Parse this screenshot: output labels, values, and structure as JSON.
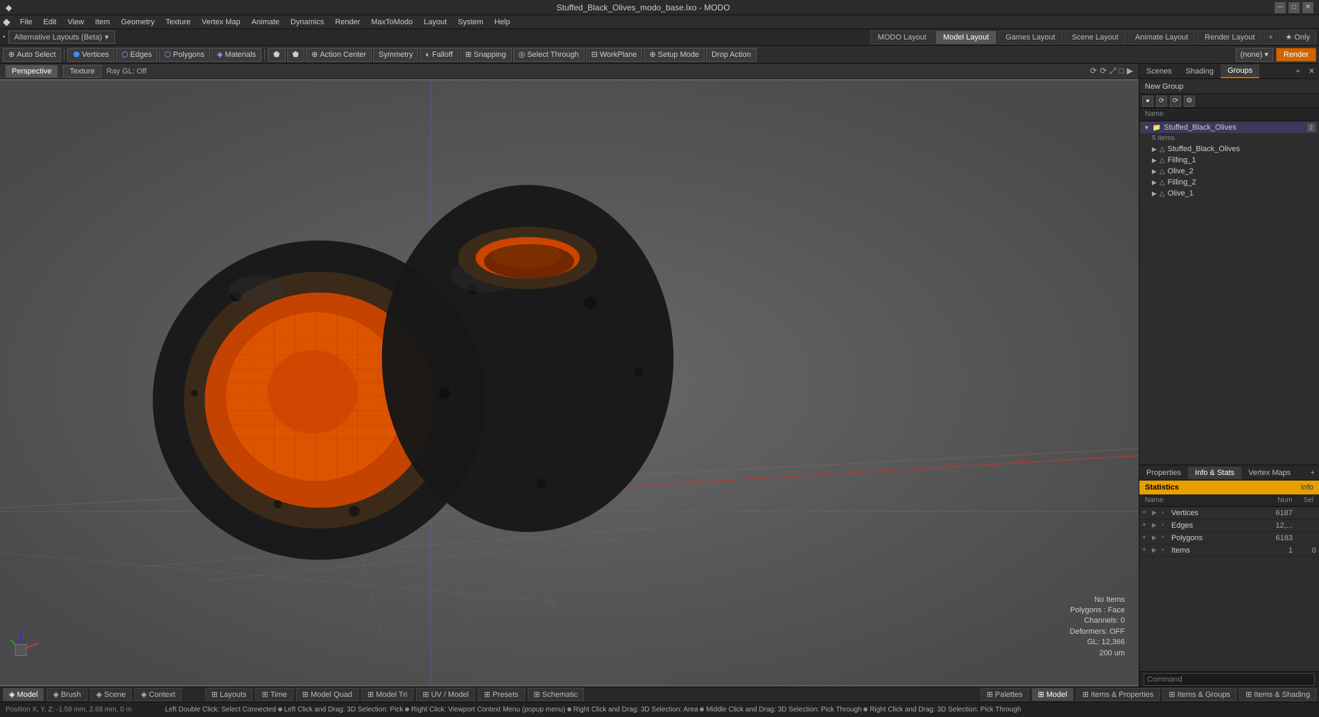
{
  "titlebar": {
    "title": "Stuffed_Black_Olives_modo_base.lxo - MODO",
    "min": "─",
    "max": "□",
    "close": "✕"
  },
  "menubar": {
    "items": [
      "File",
      "Edit",
      "View",
      "Item",
      "Geometry",
      "Texture",
      "Vertex Map",
      "Animate",
      "Dynamics",
      "Render",
      "MaxToModo",
      "Layout",
      "System",
      "Help"
    ]
  },
  "layout": {
    "label": "Alternative Layouts (Beta)",
    "tabs": [
      "MODO Layout",
      "Model Layout",
      "Games Layout",
      "Scene Layout",
      "Animate Layout",
      "Render Layout"
    ],
    "active": "Model Layout",
    "add": "+",
    "only": "★  Only"
  },
  "toolbar": {
    "auto_select": "Auto Select",
    "vertices": "Vertices",
    "edges": "Edges",
    "polygons": "Polygons",
    "materials": "Materials",
    "action_center": "Action Center",
    "symmetry": "Symmetry",
    "falloff": "Falloff",
    "snapping": "Snapping",
    "select_through": "Select Through",
    "workplane": "WorkPlane",
    "setup_mode": "Setup Mode",
    "drop_action": "Drop Action",
    "none": "(none)",
    "render": "Render"
  },
  "viewport": {
    "tabs": [
      "Perspective",
      "Texture",
      "Ray GL: Off"
    ],
    "icons": [
      "⟳",
      "⟳",
      "⤢",
      "□",
      "▶"
    ],
    "overlay": {
      "no_items": "No Items",
      "polygons": "Polygons : Face",
      "channels": "Channels: 0",
      "deformers": "Deformers: OFF",
      "gl": "GL: 12,366",
      "measure": "200 um"
    }
  },
  "right_panel": {
    "tabs": [
      "Scenes",
      "Shading",
      "Groups"
    ],
    "active": "Groups",
    "add": "+",
    "close": "✕",
    "new_group": "New Group",
    "toolbar_buttons": [
      "●",
      "⟳",
      "⟳",
      "⚙"
    ],
    "name_col": "Name",
    "tree": [
      {
        "level": 0,
        "name": "Stuffed_Black_Olives",
        "badge": "2",
        "expanded": true,
        "selected": true,
        "icon": "📁"
      },
      {
        "level": 1,
        "name": "5 Items",
        "is_count": true
      },
      {
        "level": 1,
        "name": "Stuffed_Black_Olives",
        "icon": "△",
        "expanded": false
      },
      {
        "level": 1,
        "name": "Filling_1",
        "icon": "△",
        "expanded": false
      },
      {
        "level": 1,
        "name": "Olive_2",
        "icon": "△",
        "expanded": false
      },
      {
        "level": 1,
        "name": "Filling_2",
        "icon": "△",
        "expanded": false
      },
      {
        "level": 1,
        "name": "Olive_1",
        "icon": "△",
        "expanded": false
      }
    ]
  },
  "stats_panel": {
    "tabs": [
      "Properties",
      "Info & Stats",
      "Vertex Maps"
    ],
    "active": "Info & Stats",
    "add": "+",
    "header": "Statistics",
    "info_tab": "Info",
    "columns": {
      "name": "Name",
      "num": "Num",
      "sel": "Sel"
    },
    "rows": [
      {
        "name": "Vertices",
        "num": "6187",
        "sel": ""
      },
      {
        "name": "Edges",
        "num": "12,...",
        "sel": ""
      },
      {
        "name": "Polygons",
        "num": "6183",
        "sel": ""
      },
      {
        "name": "Items",
        "num": "1",
        "sel": "0"
      }
    ]
  },
  "bottom_toolbar": {
    "left_tabs": [
      {
        "label": "Model",
        "active": true
      },
      {
        "label": "Brush",
        "active": false
      },
      {
        "label": "Scene",
        "active": false
      },
      {
        "label": "Context",
        "active": false
      }
    ],
    "right_tabs": [
      {
        "label": "Layouts"
      },
      {
        "label": "Time"
      },
      {
        "label": "Model Quad"
      },
      {
        "label": "Model Tri"
      },
      {
        "label": "UV / Model"
      },
      {
        "label": "Presets"
      },
      {
        "label": "Schematic"
      }
    ],
    "far_right": [
      {
        "label": "Palettes"
      },
      {
        "label": "Model",
        "active": true
      },
      {
        "label": "Items & Properties"
      },
      {
        "label": "Items & Groups"
      },
      {
        "label": "Items & Shading"
      }
    ]
  },
  "status_bar": {
    "position": "Position X, Y, Z:  -1.58 mm, 2.68 mm, 0 m",
    "tips": [
      "Left Double Click: Select Connected",
      "Left Click and Drag: 3D Selection: Pick",
      "Right Click: Viewport Context Menu (popup menu)",
      "Right Click and Drag: 3D Selection: Area",
      "Middle Click and Drag: 3D Selection: Pick Through",
      "Right Click and Drag: 3D Selection: Pick Through"
    ]
  },
  "command": {
    "label": "Command",
    "placeholder": "Command"
  }
}
